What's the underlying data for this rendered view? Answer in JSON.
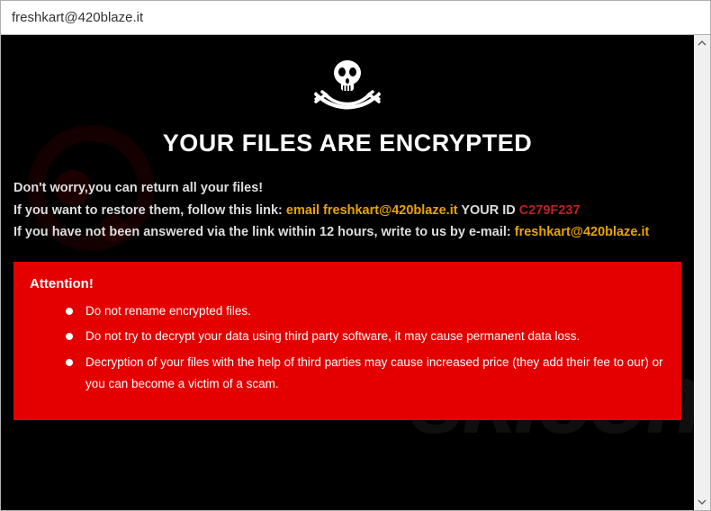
{
  "window": {
    "title": "freshkart@420blaze.it"
  },
  "skull_icon": "skull-crossbones-icon",
  "main_title": "YOUR FILES ARE ENCRYPTED",
  "lines": {
    "l1": "Don't worry,you can return all your files!",
    "l2a": "If you want to restore them, follow this link: ",
    "l2b": "email freshkart@420blaze.it",
    "l2c": "  YOUR ID ",
    "l2d": "C279F237",
    "l3a": "If you have not been answered via the link within 12 hours, write to us by e-mail: ",
    "l3b": "freshkart@420blaze.it"
  },
  "attention": {
    "title": "Attention!",
    "items": [
      "Do not rename encrypted files.",
      "Do not try to decrypt your data using third party software, it may cause permanent data loss.",
      "Decryption of your files with the help of third parties may cause increased price (they add their fee to our) or you can become a victim of a scam."
    ]
  },
  "watermark": "sk.com"
}
